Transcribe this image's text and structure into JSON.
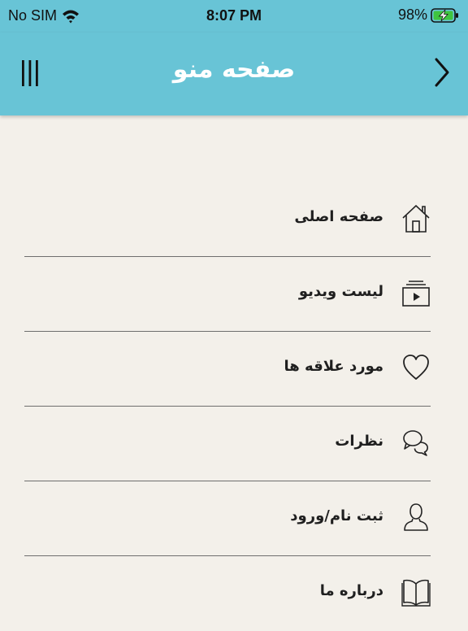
{
  "status_bar": {
    "carrier": "No SIM",
    "time": "8:07 PM",
    "battery": "98%",
    "icons": [
      "wifi-icon",
      "battery-charging-icon"
    ]
  },
  "navbar": {
    "title": "صفحه منو",
    "left_icon": "menu-bars-icon",
    "right_icon": "chevron-right-icon",
    "background": "#68c4d6"
  },
  "menu": {
    "items": [
      {
        "label": "صفحه اصلی",
        "icon": "home-icon"
      },
      {
        "label": "لیست ویدیو",
        "icon": "video-list-icon"
      },
      {
        "label": "مورد علاقه ها",
        "icon": "heart-icon"
      },
      {
        "label": "نظرات",
        "icon": "comments-icon"
      },
      {
        "label": "ثبت نام/ورود",
        "icon": "user-icon"
      },
      {
        "label": "درباره ما",
        "icon": "book-icon"
      }
    ]
  },
  "colors": {
    "accent": "#68c4d6",
    "background": "#f3f0ea"
  }
}
